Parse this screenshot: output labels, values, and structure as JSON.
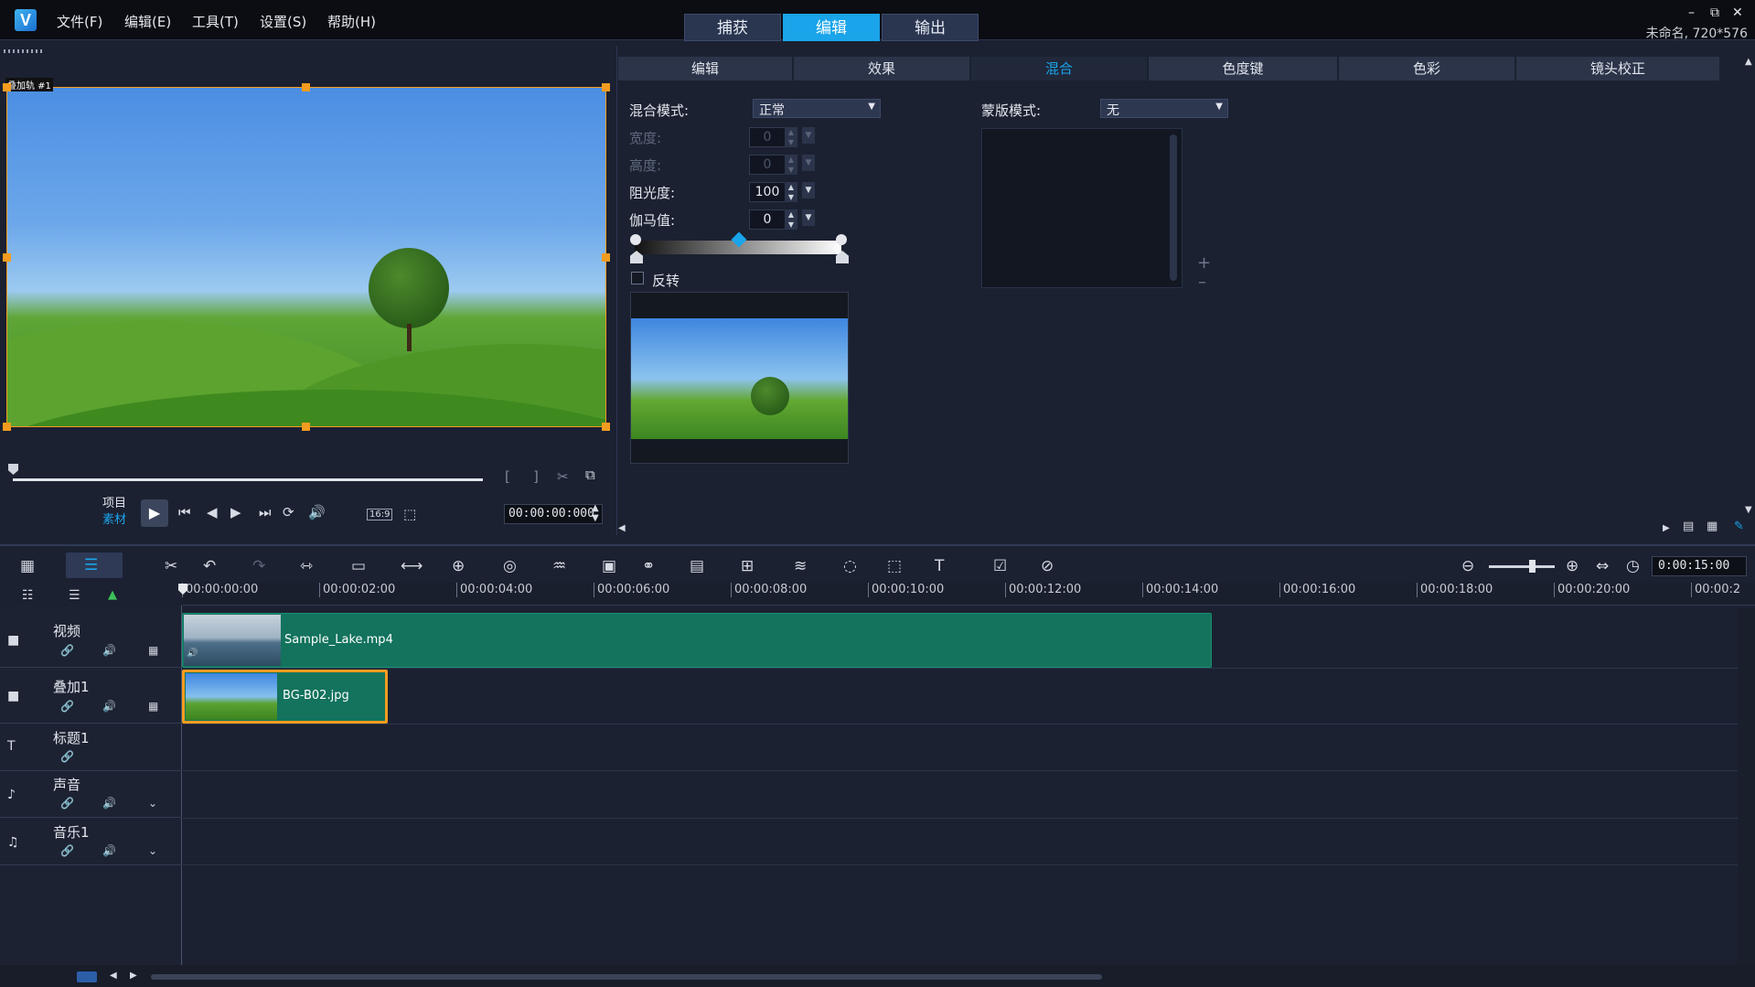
{
  "app": {
    "logo": "V",
    "project_info": "未命名, 720*576"
  },
  "menu": [
    "文件(F)",
    "编辑(E)",
    "工具(T)",
    "设置(S)",
    "帮助(H)"
  ],
  "mode_tabs": [
    {
      "label": "捕获",
      "active": false
    },
    {
      "label": "编辑",
      "active": true
    },
    {
      "label": "输出",
      "active": false
    }
  ],
  "window_controls": {
    "minimize": "–",
    "restore": "⧉",
    "close": "✕"
  },
  "preview": {
    "track_label": "叠加轨 #1",
    "project_label": "项目",
    "clip_label": "素材",
    "timecode": "00:00:00:000",
    "aspect": "16:9"
  },
  "options_tabs": [
    "编辑",
    "效果",
    "混合",
    "色度键",
    "色彩",
    "镜头校正"
  ],
  "options_active": "混合",
  "blend": {
    "blend_mode_label": "混合模式:",
    "blend_mode_value": "正常",
    "width_label": "宽度:",
    "width_value": "0",
    "height_label": "高度:",
    "height_value": "0",
    "opacity_label": "阻光度:",
    "opacity_value": "100",
    "gamma_label": "伽马值:",
    "gamma_value": "0",
    "invert_label": "反转",
    "mask_mode_label": "蒙版模式:",
    "mask_mode_value": "无",
    "add": "+",
    "remove": "–"
  },
  "timeline": {
    "duration": "0:00:15:00",
    "ruler": [
      "00:00:00:00",
      "00:00:02:00",
      "00:00:04:00",
      "00:00:06:00",
      "00:00:08:00",
      "00:00:10:00",
      "00:00:12:00",
      "00:00:14:00",
      "00:00:16:00",
      "00:00:18:00",
      "00:00:20:00",
      "00:00:2"
    ],
    "tracks": [
      {
        "name": "视频",
        "icon": "video-camera-icon"
      },
      {
        "name": "叠加1",
        "icon": "overlay-camera-icon"
      },
      {
        "name": "标题1",
        "icon": "title-icon"
      },
      {
        "name": "声音",
        "icon": "voice-icon"
      },
      {
        "name": "音乐1",
        "icon": "music-icon"
      }
    ],
    "clips": {
      "video": "Sample_Lake.mp4",
      "overlay": "BG-B02.jpg"
    }
  },
  "colors": {
    "accent": "#1aa4ea",
    "clip": "#13735d",
    "selection": "#f39c1f"
  }
}
